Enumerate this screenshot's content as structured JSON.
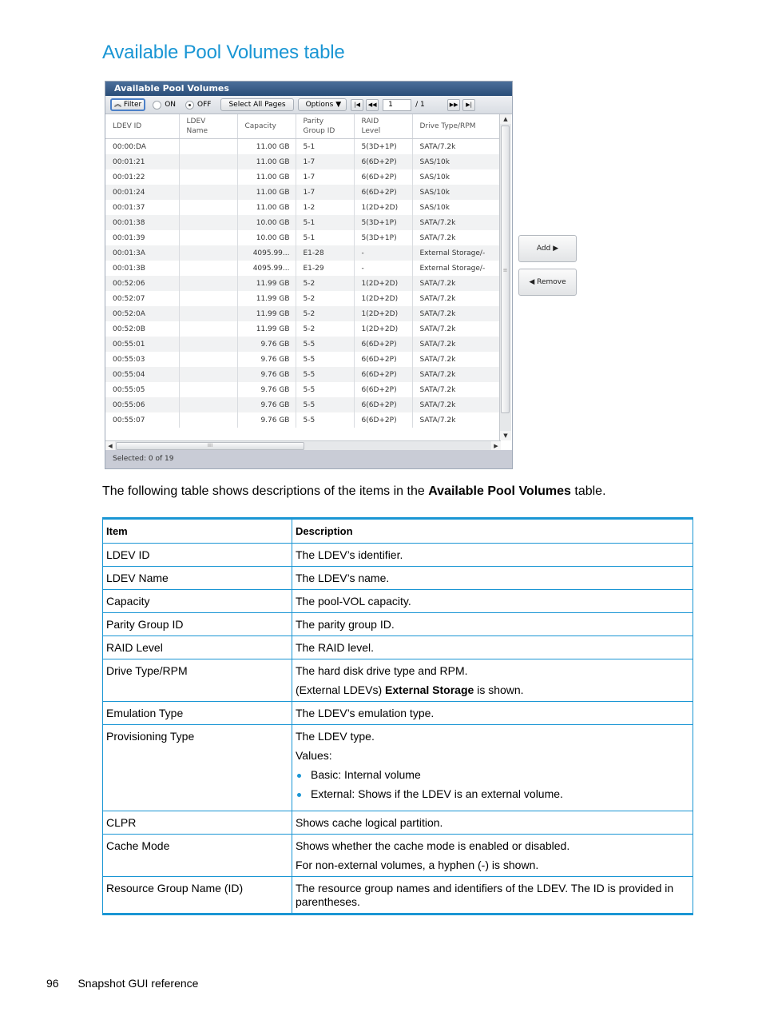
{
  "page_title": "Available Pool Volumes table",
  "gui": {
    "panel_title": "Available Pool Volumes",
    "toolbar": {
      "filter_label": "Filter",
      "filter_icon": "chevron-double-up-icon",
      "radio_on_label": "ON",
      "radio_off_label": "OFF",
      "radio_selected": "OFF",
      "select_all_label": "Select All Pages",
      "options_label": "Options",
      "first_page": "⏮",
      "prev_page": "◀◀",
      "page_value": "1",
      "page_total": "/ 1",
      "next_page": "▶▶",
      "last_page": "⏭"
    },
    "columns": [
      "LDEV ID",
      "LDEV Name",
      "Capacity",
      "Parity Group ID",
      "RAID Level",
      "Drive Type/RPM"
    ],
    "column_lines": [
      [
        "LDEV ID"
      ],
      [
        "LDEV",
        "Name"
      ],
      [
        "Capacity"
      ],
      [
        "Parity",
        "Group ID"
      ],
      [
        "RAID",
        "Level"
      ],
      [
        "Drive Type/RPM"
      ]
    ],
    "rows": [
      [
        "00:00:DA",
        "",
        "11.00 GB",
        "5-1",
        "5(3D+1P)",
        "SATA/7.2k"
      ],
      [
        "00:01:21",
        "",
        "11.00 GB",
        "1-7",
        "6(6D+2P)",
        "SAS/10k"
      ],
      [
        "00:01:22",
        "",
        "11.00 GB",
        "1-7",
        "6(6D+2P)",
        "SAS/10k"
      ],
      [
        "00:01:24",
        "",
        "11.00 GB",
        "1-7",
        "6(6D+2P)",
        "SAS/10k"
      ],
      [
        "00:01:37",
        "",
        "11.00 GB",
        "1-2",
        "1(2D+2D)",
        "SAS/10k"
      ],
      [
        "00:01:38",
        "",
        "10.00 GB",
        "5-1",
        "5(3D+1P)",
        "SATA/7.2k"
      ],
      [
        "00:01:39",
        "",
        "10.00 GB",
        "5-1",
        "5(3D+1P)",
        "SATA/7.2k"
      ],
      [
        "00:01:3A",
        "",
        "4095.99...",
        "E1-28",
        "-",
        "External Storage/-"
      ],
      [
        "00:01:3B",
        "",
        "4095.99...",
        "E1-29",
        "-",
        "External Storage/-"
      ],
      [
        "00:52:06",
        "",
        "11.99 GB",
        "5-2",
        "1(2D+2D)",
        "SATA/7.2k"
      ],
      [
        "00:52:07",
        "",
        "11.99 GB",
        "5-2",
        "1(2D+2D)",
        "SATA/7.2k"
      ],
      [
        "00:52:0A",
        "",
        "11.99 GB",
        "5-2",
        "1(2D+2D)",
        "SATA/7.2k"
      ],
      [
        "00:52:0B",
        "",
        "11.99 GB",
        "5-2",
        "1(2D+2D)",
        "SATA/7.2k"
      ],
      [
        "00:55:01",
        "",
        "9.76 GB",
        "5-5",
        "6(6D+2P)",
        "SATA/7.2k"
      ],
      [
        "00:55:03",
        "",
        "9.76 GB",
        "5-5",
        "6(6D+2P)",
        "SATA/7.2k"
      ],
      [
        "00:55:04",
        "",
        "9.76 GB",
        "5-5",
        "6(6D+2P)",
        "SATA/7.2k"
      ],
      [
        "00:55:05",
        "",
        "9.76 GB",
        "5-5",
        "6(6D+2P)",
        "SATA/7.2k"
      ],
      [
        "00:55:06",
        "",
        "9.76 GB",
        "5-5",
        "6(6D+2P)",
        "SATA/7.2k"
      ],
      [
        "00:55:07",
        "",
        "9.76 GB",
        "5-5",
        "6(6D+2P)",
        "SATA/7.2k"
      ]
    ],
    "status": "Selected:  0   of 19",
    "add_label": "Add",
    "remove_label": "Remove"
  },
  "intro": {
    "before": "The following table shows descriptions of the items in the ",
    "bold": "Available Pool Volumes",
    "after": " table."
  },
  "desc_table": {
    "headers": [
      "Item",
      "Description"
    ],
    "rows": [
      {
        "item": "LDEV ID",
        "lines": [
          "The LDEV’s identifier."
        ]
      },
      {
        "item": "LDEV Name",
        "lines": [
          "The LDEV’s name."
        ]
      },
      {
        "item": "Capacity",
        "lines": [
          "The pool-VOL capacity."
        ]
      },
      {
        "item": "Parity Group ID",
        "lines": [
          "The parity group ID."
        ]
      },
      {
        "item": "RAID Level",
        "lines": [
          "The RAID level."
        ]
      },
      {
        "item": "Drive Type/RPM",
        "lines": [
          "The hard disk drive type and RPM."
        ],
        "rich": {
          "before": "(External LDEVs) ",
          "bold": "External Storage",
          "after": " is shown."
        }
      },
      {
        "item": "Emulation Type",
        "lines": [
          "The LDEV’s emulation type."
        ]
      },
      {
        "item": "Provisioning Type",
        "lines": [
          "The LDEV type.",
          "Values:"
        ],
        "bullets": [
          "Basic: Internal volume",
          "External: Shows if the LDEV is an external volume."
        ]
      },
      {
        "item": "CLPR",
        "lines": [
          "Shows cache logical partition."
        ]
      },
      {
        "item": "Cache Mode",
        "lines": [
          "Shows whether the cache mode is enabled or disabled.",
          "For non-external volumes, a hyphen (-) is shown."
        ]
      },
      {
        "item": "Resource Group Name (ID)",
        "lines": [
          "The resource group names and identifiers of the LDEV. The ID is provided in parentheses."
        ]
      }
    ]
  },
  "footer": {
    "page_number": "96",
    "section": "Snapshot GUI reference"
  },
  "colors": {
    "accent": "#1a96d4",
    "panel_header": "#2a4d78",
    "status_bar": "#c9ccd6"
  }
}
